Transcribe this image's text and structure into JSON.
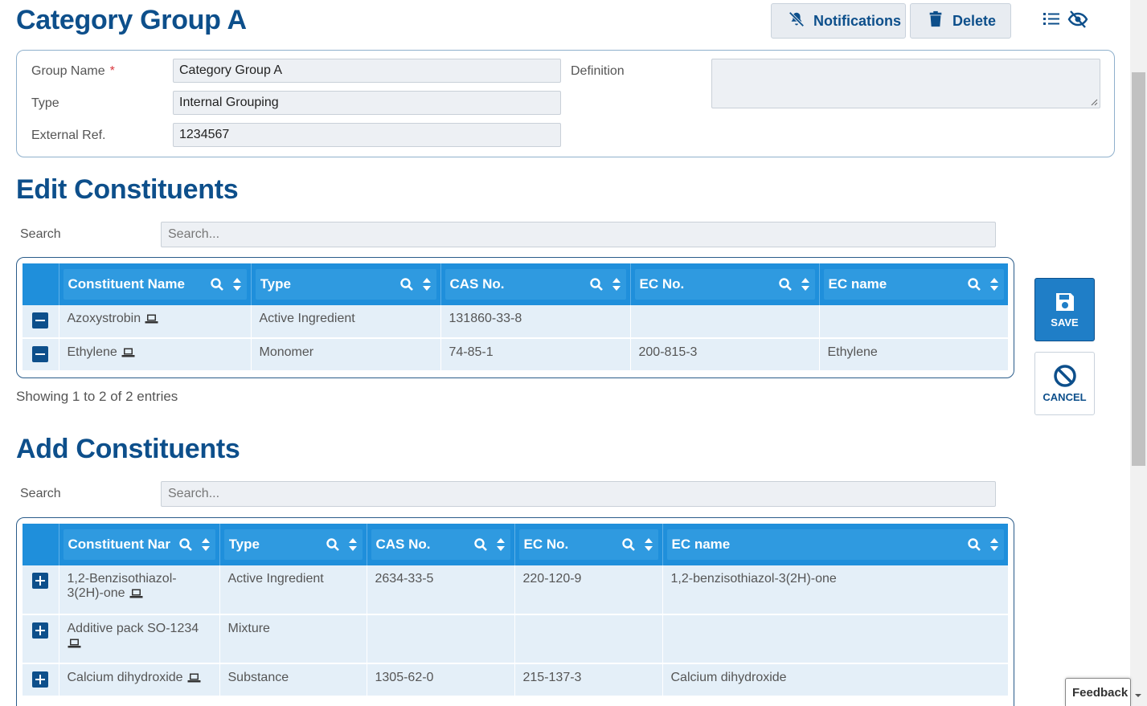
{
  "header": {
    "title": "Category Group A",
    "notifications_label": "Notifications",
    "delete_label": "Delete"
  },
  "form": {
    "group_name_label": "Group Name",
    "required_marker": "*",
    "group_name_value": "Category Group A",
    "type_label": "Type",
    "type_value": "Internal Grouping",
    "external_ref_label": "External Ref.",
    "external_ref_value": "1234567",
    "definition_label": "Definition",
    "definition_value": ""
  },
  "edit": {
    "title": "Edit Constituents",
    "search_label": "Search",
    "search_placeholder": "Search...",
    "columns": [
      "Constituent Name",
      "Type",
      "CAS No.",
      "EC No.",
      "EC name"
    ],
    "rows": [
      {
        "name": "Azoxystrobin",
        "type": "Active Ingredient",
        "cas": "131860-33-8",
        "ec": "",
        "ec_name": ""
      },
      {
        "name": "Ethylene",
        "type": "Monomer",
        "cas": "74-85-1",
        "ec": "200-815-3",
        "ec_name": "Ethylene"
      }
    ],
    "entries_text": "Showing 1 to 2 of 2 entries"
  },
  "add": {
    "title": "Add Constituents",
    "search_label": "Search",
    "search_placeholder": "Search...",
    "columns": [
      "Constituent Nar",
      "Type",
      "CAS No.",
      "EC No.",
      "EC name"
    ],
    "rows": [
      {
        "name": "1,2-Benzisothiazol-3(2H)-one",
        "type": "Active Ingredient",
        "cas": "2634-33-5",
        "ec": "220-120-9",
        "ec_name": "1,2-benzisothiazol-3(2H)-one"
      },
      {
        "name": "Additive pack SO-1234",
        "type": "Mixture",
        "cas": "",
        "ec": "",
        "ec_name": ""
      },
      {
        "name": "Calcium dihydroxide",
        "type": "Substance",
        "cas": "1305-62-0",
        "ec": "215-137-3",
        "ec_name": "Calcium dihydroxide"
      }
    ]
  },
  "actions": {
    "save_label": "SAVE",
    "cancel_label": "CANCEL"
  },
  "feedback_label": "Feedback",
  "icons": {
    "notifications": "bell-slash-icon",
    "delete": "trash-icon",
    "list_toggle": "list-eye-slash-icon",
    "save": "floppy-disk-icon",
    "cancel": "ban-icon",
    "constituent": "laptop-icon"
  },
  "colors": {
    "brand": "#0d4f8b",
    "header_blue": "#1f8fdb",
    "row_bg": "#e4eff8",
    "save_bg": "#1f7ec7"
  }
}
